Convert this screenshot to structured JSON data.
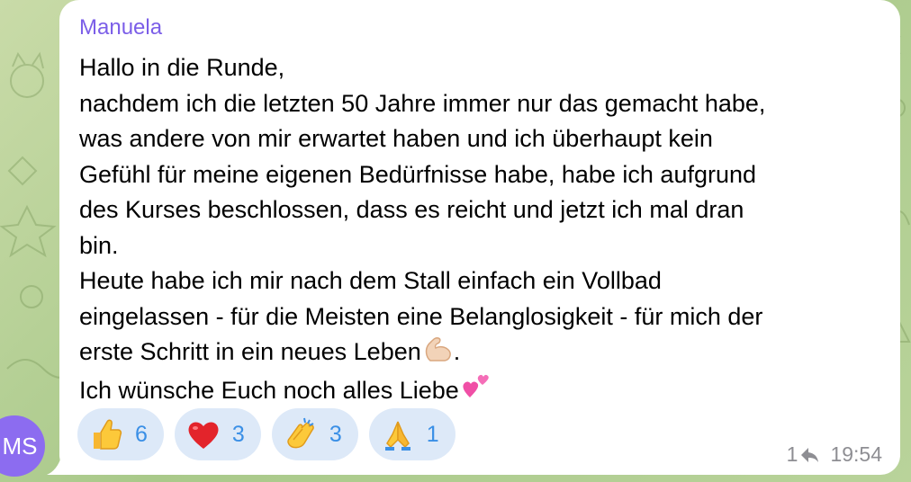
{
  "chat": {
    "sender_name": "Manuela",
    "message_lines": [
      "Hallo in die Runde,",
      "nachdem ich die letzten 50 Jahre immer nur das gemacht habe,",
      "was andere von mir erwartet haben und ich überhaupt kein",
      "Gefühl für meine eigenen Bedürfnisse habe, habe ich aufgrund",
      "des Kurses beschlossen, dass es reicht und jetzt ich mal dran",
      "bin.",
      "Heute habe ich mir nach dem Stall einfach ein Vollbad",
      "eingelassen - für die Meisten eine Belanglosigkeit - für mich der",
      "erste Schritt in ein neues Leben",
      "Ich wünsche Euch noch alles Liebe"
    ],
    "line9_suffix": ".",
    "emoji_flexed_biceps": "flexed-biceps-icon",
    "emoji_two_hearts": "two-hearts-icon",
    "avatar_initials": "MS",
    "reactions": [
      {
        "icon": "thumbs-up-icon",
        "count": "6"
      },
      {
        "icon": "red-heart-icon",
        "count": "3"
      },
      {
        "icon": "clapping-hands-icon",
        "count": "3"
      },
      {
        "icon": "folded-hands-icon",
        "count": "1"
      }
    ],
    "reply_count": "1",
    "time": "19:54"
  },
  "colors": {
    "sender": "#7b5ee8",
    "reaction_bg": "#dde9f8",
    "reaction_count": "#3a8fe6",
    "meta": "#8e8e93",
    "avatar_bg": "#8c6cf0",
    "wallpaper": "#b9d39a"
  }
}
